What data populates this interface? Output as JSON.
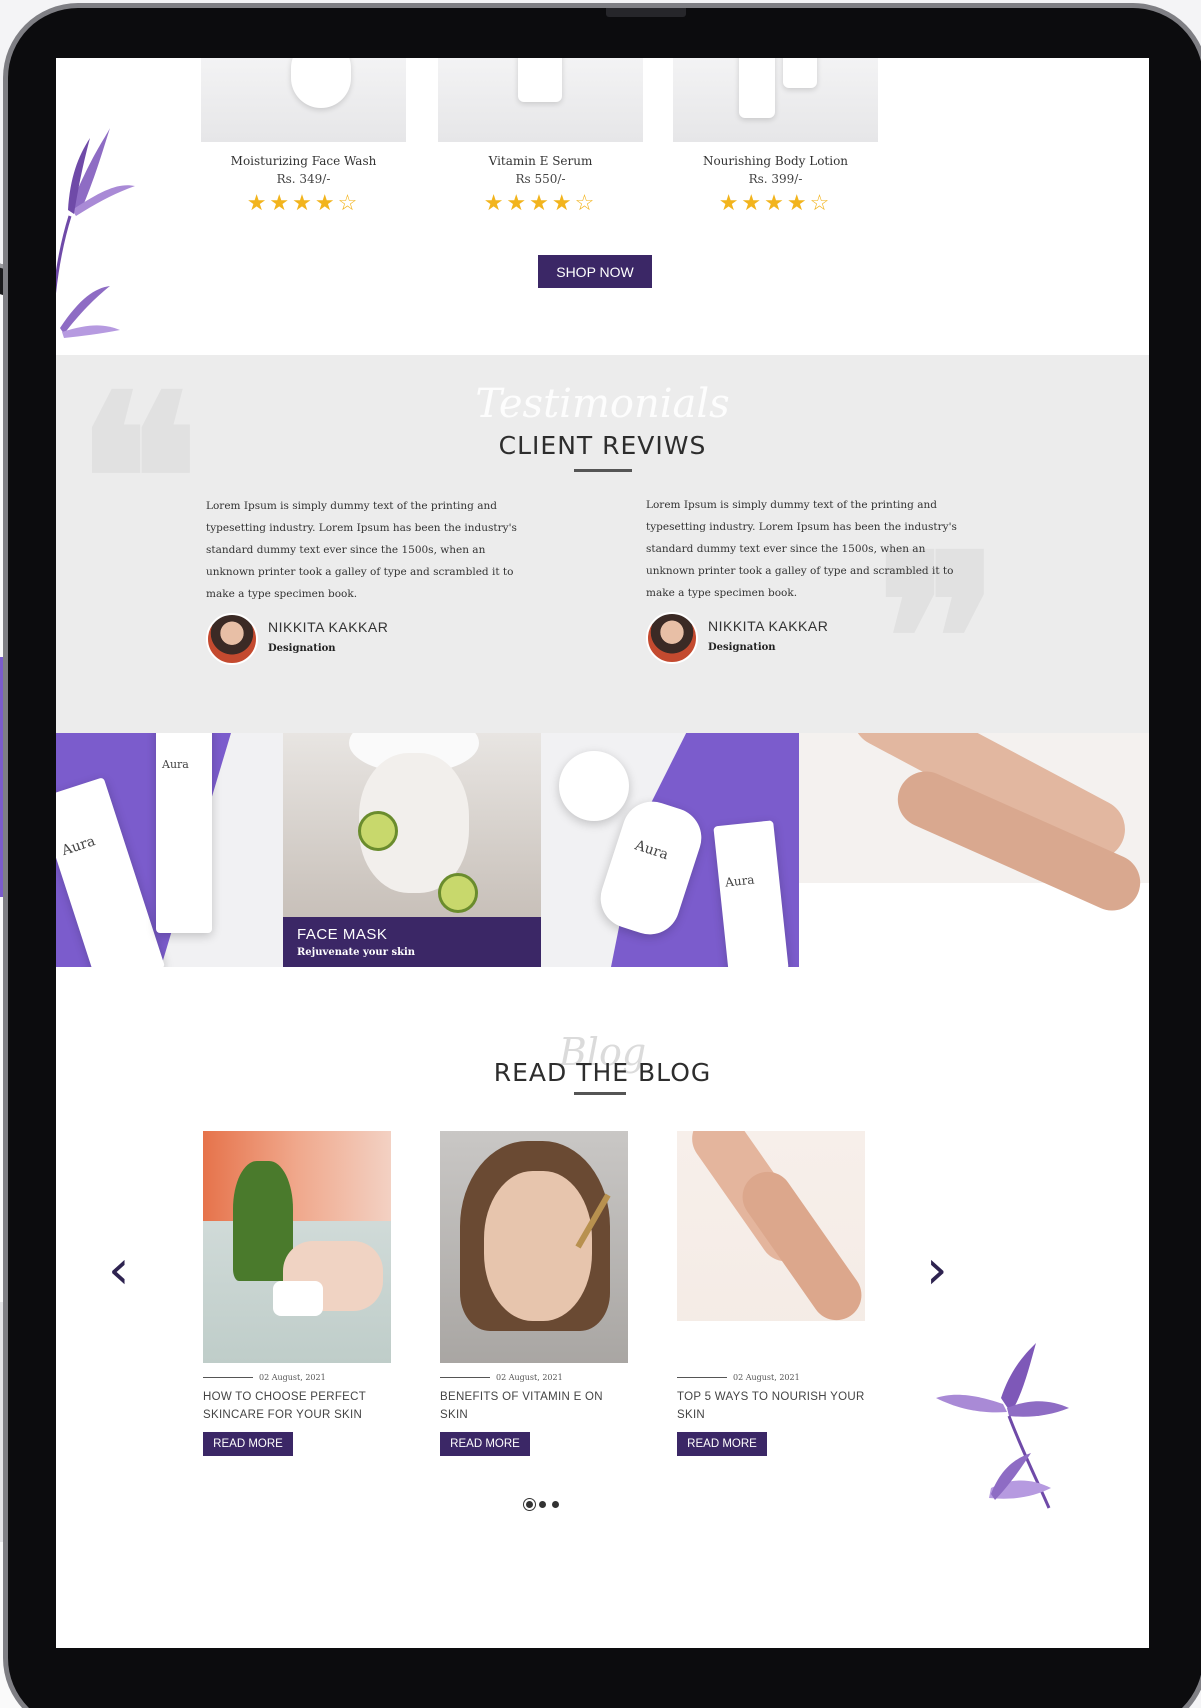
{
  "products": [
    {
      "name": "Moisturizing Face Wash",
      "price": "Rs. 349/-",
      "rating": 4,
      "max_rating": 5
    },
    {
      "name": "Vitamin E Serum",
      "price": "Rs 550/-",
      "rating": 4,
      "max_rating": 5
    },
    {
      "name": "Nourishing Body Lotion",
      "price": "Rs. 399/-",
      "rating": 4,
      "max_rating": 5
    }
  ],
  "stars": {
    "filled": "★★★★",
    "empty": "☆"
  },
  "shop_now_label": "SHOP NOW",
  "testimonials": {
    "script_label": "Testimonials",
    "title": "CLIENT REVIWS",
    "reviews": [
      {
        "text": "Lorem Ipsum is simply dummy text of the printing and typesetting industry. Lorem Ipsum has been the industry's standard dummy text ever since the 1500s, when an unknown printer took a galley of type and scrambled it to make a type specimen book.",
        "name": "NIKKITA KAKKAR",
        "designation": "Designation"
      },
      {
        "text": "Lorem Ipsum is simply dummy text of the printing and typesetting industry. Lorem Ipsum has been the industry's standard dummy text ever since the 1500s, when an unknown printer took a galley of type and scrambled it to make a type specimen book.",
        "name": "NIKKITA KAKKAR",
        "designation": "Designation"
      }
    ]
  },
  "banner": {
    "brand": "Aura",
    "caption_title": "FACE MASK",
    "caption_subtitle": "Rejuvenate your skin"
  },
  "blog": {
    "script_label": "Blog",
    "title": "READ THE BLOG",
    "prev_icon": "‹",
    "next_icon": "›",
    "posts": [
      {
        "date": "02 August, 2021",
        "title": "HOW TO CHOOSE PERFECT SKINCARE FOR YOUR SKIN",
        "button": "READ MORE"
      },
      {
        "date": "02 August, 2021",
        "title": "BENEFITS OF VITAMIN E ON SKIN",
        "button": "READ MORE"
      },
      {
        "date": "02 August, 2021",
        "title": "TOP 5 WAYS TO NOURISH YOUR SKIN",
        "button": "READ MORE"
      }
    ]
  },
  "colors": {
    "brand_purple": "#3b2766",
    "accent_lavender": "#7b5ccc",
    "star": "#f2b41d"
  }
}
